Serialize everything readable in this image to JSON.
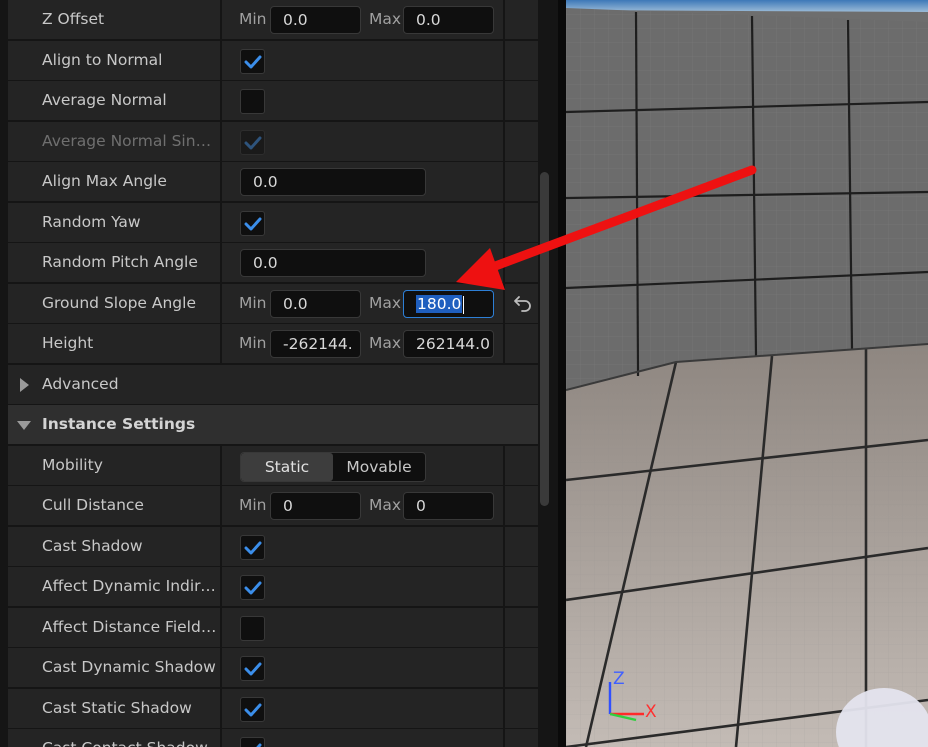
{
  "details": {
    "rows": [
      {
        "type": "minmax",
        "name": "Z Offset",
        "min_label": "Min",
        "min": "0.0",
        "max_label": "Max",
        "max": "0.0"
      },
      {
        "type": "check",
        "name": "Align to Normal",
        "checked": true
      },
      {
        "type": "check",
        "name": "Average Normal",
        "checked": false
      },
      {
        "type": "check",
        "name": "Average Normal Single…",
        "checked": true,
        "disabled": true
      },
      {
        "type": "value",
        "name": "Align Max Angle",
        "value": "0.0"
      },
      {
        "type": "check",
        "name": "Random Yaw",
        "checked": true
      },
      {
        "type": "value",
        "name": "Random Pitch Angle",
        "value": "0.0"
      },
      {
        "type": "minmax",
        "name": "Ground Slope Angle",
        "min_label": "Min",
        "min": "0.0",
        "max_label": "Max",
        "max": "180.0",
        "max_focused": true,
        "has_reset": true
      },
      {
        "type": "minmax",
        "name": "Height",
        "min_label": "Min",
        "min": "-262144.",
        "max_label": "Max",
        "max": "262144.0"
      },
      {
        "type": "subcategory",
        "name": "Advanced",
        "expanded": false
      },
      {
        "type": "category",
        "name": "Instance Settings",
        "expanded": true
      },
      {
        "type": "segmented",
        "name": "Mobility",
        "options": [
          "Static",
          "Movable"
        ],
        "selected": "Static"
      },
      {
        "type": "minmax",
        "name": "Cull Distance",
        "min_label": "Min",
        "min": "0",
        "max_label": "Max",
        "max": "0"
      },
      {
        "type": "check",
        "name": "Cast Shadow",
        "checked": true
      },
      {
        "type": "check",
        "name": "Affect Dynamic Indirec…",
        "checked": true
      },
      {
        "type": "check",
        "name": "Affect Distance Field Li…",
        "checked": false
      },
      {
        "type": "check",
        "name": "Cast Dynamic Shadow",
        "checked": true
      },
      {
        "type": "check",
        "name": "Cast Static Shadow",
        "checked": true
      },
      {
        "type": "check",
        "name": "Cast Contact Shadow",
        "checked": true
      }
    ]
  },
  "viewport": {
    "axis_z": "Z",
    "axis_x": "X"
  },
  "colors": {
    "accent": "#2d7fd6",
    "check_mark": "#3b8eea",
    "arrow": "#ee1111"
  },
  "icons": {
    "reset": "reset-to-default-icon",
    "expand": "triangle-right-icon",
    "collapse": "triangle-down-icon"
  }
}
